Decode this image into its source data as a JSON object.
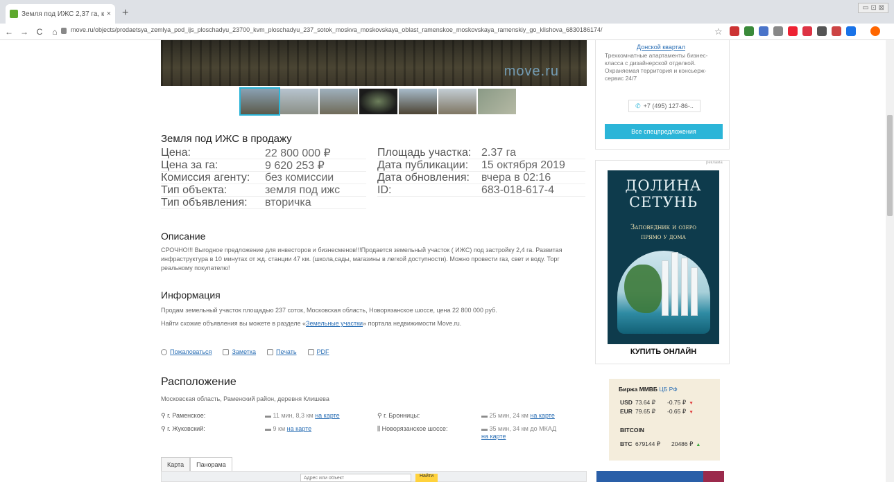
{
  "browser": {
    "tab_title": "Земля под ИЖС 2,37 га, купит…",
    "tab_close": "×",
    "new_tab": "+",
    "window_controls": "▭ ⊡ ⊠",
    "url": "move.ru/objects/prodaetsya_zemlya_pod_ijs_ploschadyu_23700_kvm_ploschadyu_237_sotok_moskva_moskovskaya_oblast_ramenskoe_moskovskaya_ramenskiy_go_klishova_6830186174/",
    "nav": {
      "back": "←",
      "forward": "→",
      "reload": "C",
      "home": "⌂"
    },
    "star": "☆"
  },
  "hero": {
    "logo_text": "move.ru"
  },
  "thumbnails_count": 7,
  "listing": {
    "title": "Земля под ИЖС в продажу",
    "specs_left": [
      {
        "label": "Цена:",
        "value": "22 800 000 ₽"
      },
      {
        "label": "Цена за га:",
        "value": "9 620 253 ₽"
      },
      {
        "label": "Комиссия агенту:",
        "value": "без комиссии"
      },
      {
        "label": "Тип объекта:",
        "value": "земля под ижс"
      },
      {
        "label": "Тип объявления:",
        "value": "вторичка"
      }
    ],
    "specs_right": [
      {
        "label": "Площадь участка:",
        "value": "2.37 га"
      },
      {
        "label": "Дата публикации:",
        "value": "15 октября 2019"
      },
      {
        "label": "Дата обновления:",
        "value": "вчера в 02:16"
      },
      {
        "label": "ID:",
        "value": "683-018-617-4"
      }
    ]
  },
  "description": {
    "title": "Описание",
    "text": "СРОЧНО!!! Выгодное предложение для инвесторов и бизнесменов!!!Продается земельный участок ( ИЖС) под застройку 2,4 га. Развитая инфраструктура в 10 минутах от жд. станции 47 км. (школа,сады, магазины в легкой доступности). Можно провести газ, свет и воду. Торг реальному покупателю!"
  },
  "information": {
    "title": "Информация",
    "line1": "Продам земельный участок площадью 237 соток, Московская область, Новорязанское шоссе, цена 22 800 000 руб.",
    "line2_prefix": "Найти схожие объявления вы можете в разделе «",
    "line2_link": "Земельные участки",
    "line2_suffix": "» портала недвижимости Move.ru."
  },
  "actions": [
    {
      "label": "Пожаловаться",
      "icon": "alert-icon"
    },
    {
      "label": "Заметка",
      "icon": "note-icon"
    },
    {
      "label": "Печать",
      "icon": "printer-icon"
    },
    {
      "label": "PDF",
      "icon": "pdf-icon"
    }
  ],
  "location": {
    "title": "Расположение",
    "address": "Московская область, Раменский район, деревня Клишева",
    "rows": [
      {
        "place": "г. Раменское:",
        "dist": "11 мин, 8,3 км",
        "map": "на карте"
      },
      {
        "place": "г. Жуковский:",
        "dist": "9 км",
        "map": "на карте"
      },
      {
        "place": "г. Бронницы:",
        "dist": "25 мин, 24 км",
        "map": "на карте"
      },
      {
        "place": "Новорязанское шоссе:",
        "dist": "35 мин, 34 км до МКАД",
        "map": "на карте"
      }
    ]
  },
  "map": {
    "tabs": [
      "Карта",
      "Панорама"
    ],
    "search_placeholder": "Адрес или объект",
    "find_button": "Найти"
  },
  "promo": {
    "link": "Донской квартал",
    "text": "Трехкомнатные апартаменты бизнес-класса с дизайнерской отделкой. Охраняемая территория и консьерж-сервис 24/7",
    "phone": "+7 (495) 127-86-..",
    "button": "Все спецпредложения"
  },
  "ad": {
    "label": "реклама",
    "title1": "ДОЛИНА",
    "title2": "СЕТУНЬ",
    "subtitle1": "Заповедник и озеро",
    "subtitle2": "прямо у дома",
    "cta": "КУПИТЬ ОНЛАЙН"
  },
  "exchange": {
    "title": "Биржа ММВБ",
    "cb": "ЦБ РФ",
    "rows": [
      {
        "code": "USD",
        "rate": "73.64 ₽",
        "change": "-0.75 ₽"
      },
      {
        "code": "EUR",
        "rate": "79.65 ₽",
        "change": "-0.65 ₽"
      }
    ],
    "btc_title": "BITCOIN",
    "btc": {
      "code": "BTC",
      "rate": "679144 ₽",
      "change": "20486 ₽"
    }
  },
  "colors": {
    "accent": "#2bb5d8",
    "link": "#2b6fb5",
    "fx_bg": "#f4eddc",
    "ad_bg": "#0e3b4c"
  }
}
